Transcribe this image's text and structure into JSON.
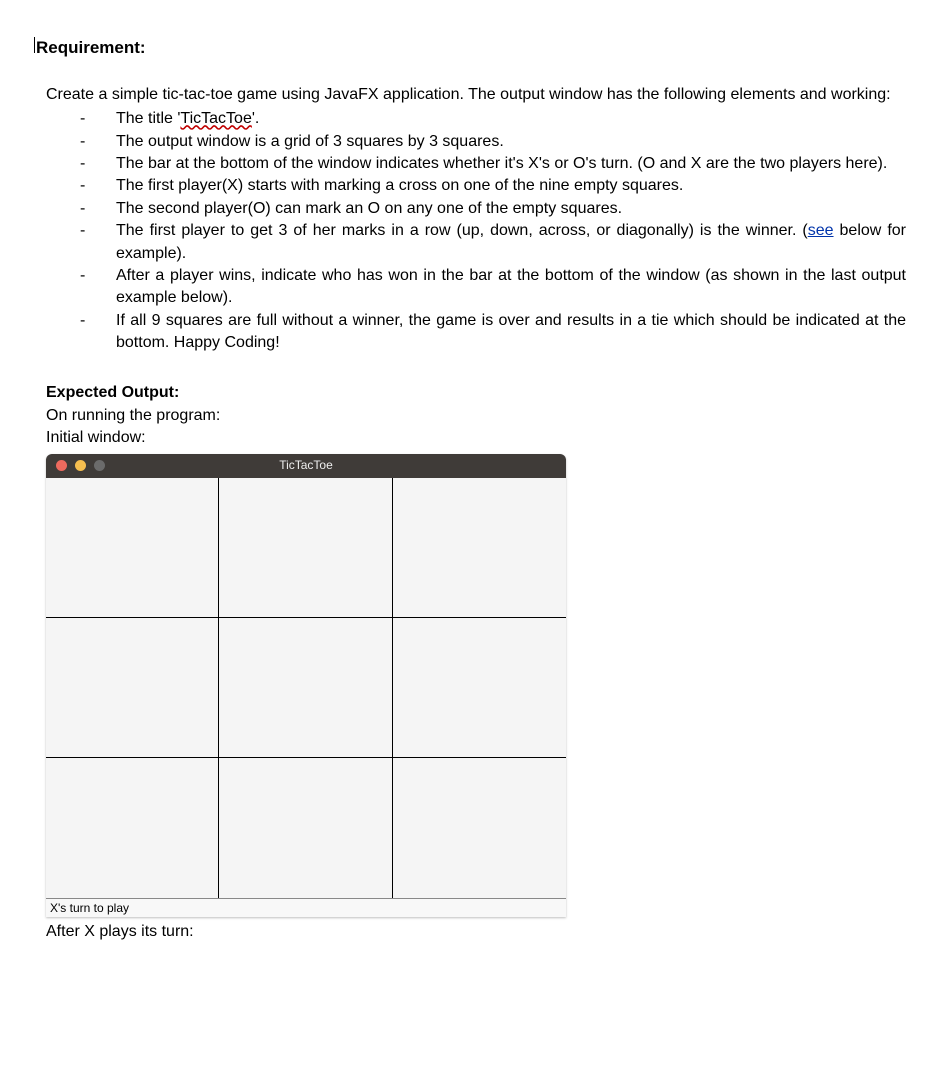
{
  "headings": {
    "requirement": "Requirement:",
    "expected": "Expected Output:"
  },
  "intro": "Create a simple tic-tac-toe game using JavaFX application. The output window has the following elements and working:",
  "bullets": [
    {
      "pre": "The title '",
      "squiggle": "TicTacToe",
      "post": "'."
    },
    {
      "text": "The output window is a grid of 3 squares by 3 squares."
    },
    {
      "text": "The bar at the bottom of the window indicates whether it's X's or O's turn. (O and X are the two players here)."
    },
    {
      "text": "The first player(X) starts with marking a cross on one of the nine empty squares."
    },
    {
      "text": "The second player(O) can mark an O on any one of the empty squares."
    },
    {
      "pre": "The first player to get 3 of her marks in a row (up, down, across, or diagonally) is the winner. (",
      "link": "see",
      "post": " below for example)."
    },
    {
      "text": "After a player wins, indicate who has won in the bar at the bottom of the window (as shown in the last output example below)."
    },
    {
      "text": "If all 9 squares are full without a winner, the game is over and results in a tie which should be indicated at the bottom. Happy Coding!"
    }
  ],
  "on_running": "On running the program:",
  "initial_window": "Initial window:",
  "app": {
    "title": "TicTacToe",
    "status": "X's turn to play"
  },
  "after_x": "After X plays its turn:"
}
